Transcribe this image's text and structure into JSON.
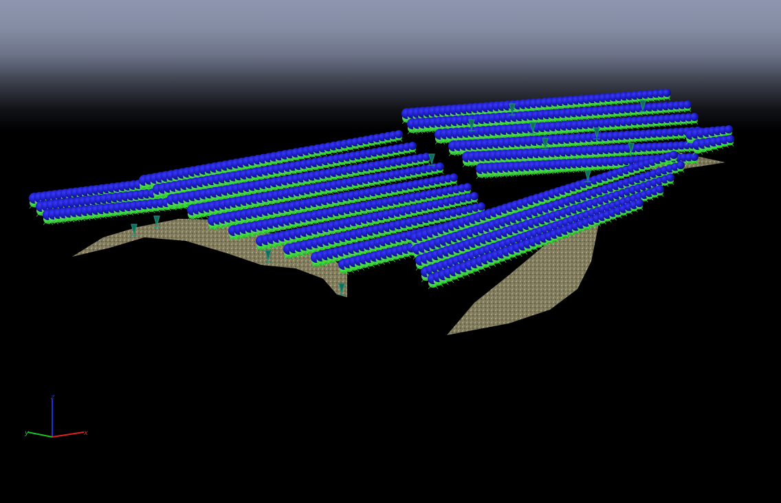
{
  "viewer": {
    "background_top_color": "#8d96ae",
    "background_bottom_color": "#000000"
  },
  "scene": {
    "terrain_color": "#9c9370",
    "camera_sphere_top_color": "#1a1ab8",
    "camera_sphere_bottom_color": "#36d83a",
    "camera_frustum_color": "#33ff33"
  },
  "axes": {
    "x_label": "x",
    "y_label": "y",
    "z_label": "z",
    "x_color": "#e02020",
    "y_color": "#20c020",
    "z_color": "#2030e0"
  }
}
